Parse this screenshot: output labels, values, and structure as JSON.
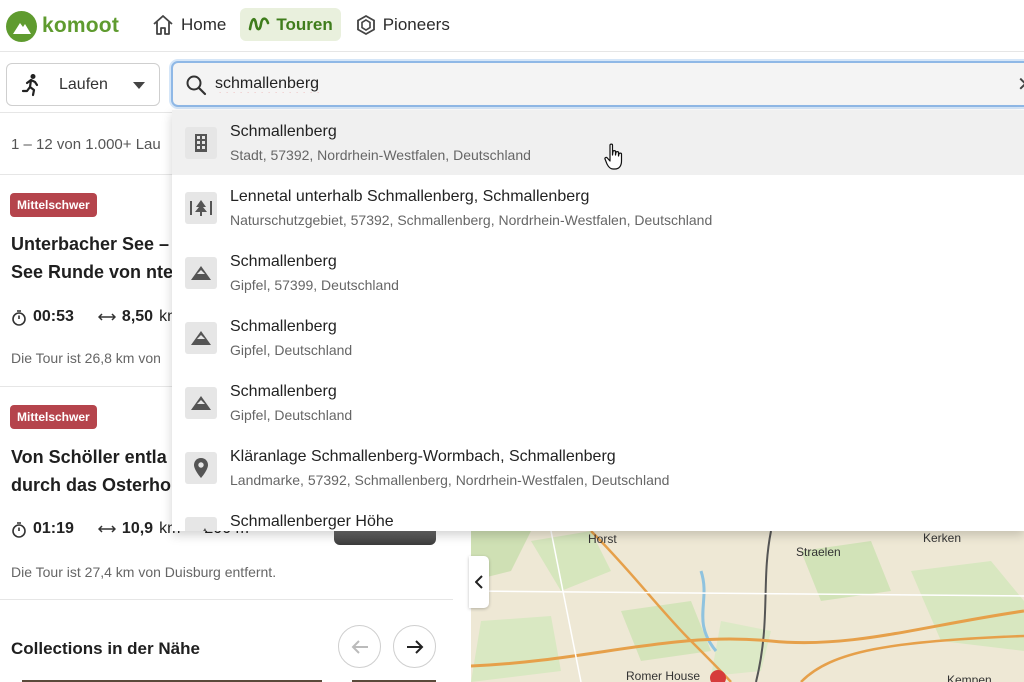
{
  "header": {
    "logo_text": "komoot",
    "nav": [
      {
        "label": "Home",
        "icon": "home-icon"
      },
      {
        "label": "Touren",
        "icon": "route-icon",
        "active": true
      },
      {
        "label": "Pioneers",
        "icon": "hexagon-icon"
      }
    ]
  },
  "search": {
    "sport": "Laufen",
    "query": "schmallenberg",
    "suggestions": [
      {
        "title": "Schmallenberg",
        "subtitle": "Stadt, 57392, Nordrhein-Westfalen, Deutschland",
        "icon": "city-icon"
      },
      {
        "title": "Lennetal unterhalb Schmallenberg, Schmallenberg",
        "subtitle": "Naturschutzgebiet, 57392, Schmallenberg, Nordrhein-Westfalen, Deutschland",
        "icon": "nature-reserve-icon"
      },
      {
        "title": "Schmallenberg",
        "subtitle": "Gipfel, 57399, Deutschland",
        "icon": "peak-icon"
      },
      {
        "title": "Schmallenberg",
        "subtitle": "Gipfel, Deutschland",
        "icon": "peak-icon"
      },
      {
        "title": "Schmallenberg",
        "subtitle": "Gipfel, Deutschland",
        "icon": "peak-icon"
      },
      {
        "title": "Kläranlage Schmallenberg-Wormbach, Schmallenberg",
        "subtitle": "Landmarke, 57392, Schmallenberg, Nordrhein-Westfalen, Deutschland",
        "icon": "location-pin-icon"
      },
      {
        "title": "Schmallenberger Höhe",
        "subtitle": "",
        "icon": "ridge-icon"
      }
    ]
  },
  "results": {
    "count_text": "1 – 12 von 1.000+ Lau",
    "tours": [
      {
        "difficulty": "Mittelschwer",
        "title_line1": "Unterbacher See –",
        "title_line2": "See Runde von nte",
        "duration": "00:53",
        "distance": "8,50",
        "distance_unit": "km",
        "note": "Die Tour ist 26,8 km von"
      },
      {
        "difficulty": "Mittelschwer",
        "title_line1": "Von Schöller entla",
        "title_line2": "durch das Osterho",
        "duration": "01:19",
        "distance": "10,9",
        "distance_unit": "km",
        "elevation": "200 m",
        "note": "Die Tour ist 27,4 km von Duisburg entfernt."
      }
    ],
    "collections_title": "Collections in der Nähe"
  },
  "map": {
    "labels": [
      "Horst",
      "Straelen",
      "Kerken",
      "Romer House",
      "Kempen"
    ]
  },
  "colors": {
    "brand_green": "#5f9b2f",
    "badge_red": "#b5444c",
    "focus_blue": "#8fb8e6"
  }
}
